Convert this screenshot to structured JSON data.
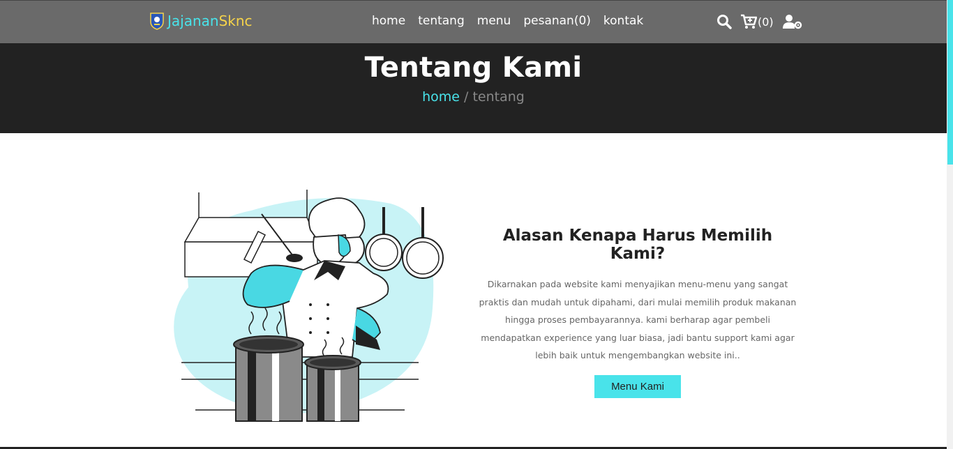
{
  "brand": {
    "name_part1": "Jajanan",
    "name_part2": "Sknc"
  },
  "nav": {
    "links": [
      {
        "label": "home"
      },
      {
        "label": "tentang"
      },
      {
        "label": "menu"
      },
      {
        "label": "pesanan(0)"
      },
      {
        "label": "kontak"
      }
    ],
    "icons": [
      "search-icon",
      "cart-icon",
      "user-settings-icon"
    ],
    "cart_count": "(0)"
  },
  "hero": {
    "title": "Tentang Kami",
    "breadcrumb_home": "home",
    "breadcrumb_sep": " / ",
    "breadcrumb_current": "tentang"
  },
  "about": {
    "heading": "Alasan Kenapa Harus Memilih Kami?",
    "body": "Dikarnakan pada website kami menyajikan menu-menu yang sangat praktis dan mudah untuk dipahami, dari mulai memilih produk makanan hingga proses pembayarannya. kami berharap agar pembeli mendapatkan experience yang luar biasa, jadi bantu support kami agar lebih baik untuk mengembangkan website ini..",
    "button_label": "Menu Kami"
  },
  "colors": {
    "accent": "#49e3ea",
    "brand_yellow": "#f5d34a",
    "navbar": "#6a6a6a",
    "hero": "#222222"
  }
}
